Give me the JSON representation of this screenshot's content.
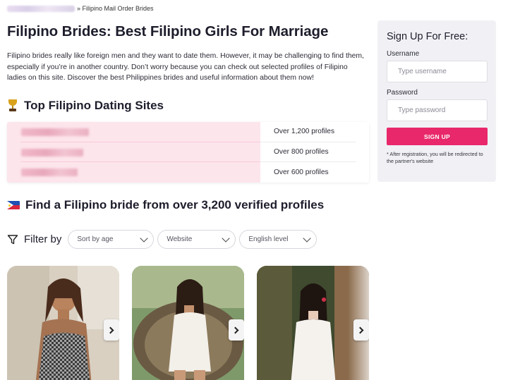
{
  "breadcrumb": {
    "current": "» Filipino Mail Order Brides"
  },
  "page": {
    "title": "Filipino Brides: Best Filipino Girls For Marriage",
    "intro": "Filipino brides really like foreign men and they want to date them. However, it may be challenging to find them, especially if you’re in another country. Don’t worry because you can check out selected profiles of Filipino ladies on this site. Discover the best Philippines brides and useful information about them now!"
  },
  "top_sites": {
    "heading": "Top Filipino Dating Sites",
    "rows": [
      {
        "profiles": "Over 1,200 profiles"
      },
      {
        "profiles": "Over 800 profiles"
      },
      {
        "profiles": "Over 600 profiles"
      }
    ]
  },
  "signup": {
    "title": "Sign Up For Free:",
    "username_label": "Username",
    "username_placeholder": "Type username",
    "password_label": "Password",
    "password_placeholder": "Type password",
    "button_label": "SIGN UP",
    "note": "* After registration, you will be redirected to the partner's website"
  },
  "find": {
    "heading": "Find a Filipino bride from over 3,200 verified profiles"
  },
  "filter": {
    "label": "Filter by",
    "selects": [
      {
        "value": "Sort by age"
      },
      {
        "value": "Website"
      },
      {
        "value": "English level"
      }
    ]
  },
  "icons": {
    "trophy": "trophy-icon",
    "flag": "philippines-flag-icon",
    "filter": "funnel-icon",
    "chevron": "chevron-down-icon",
    "next": "chevron-right-icon"
  },
  "colors": {
    "accent": "#e8286a",
    "table_highlight": "#fde5ec",
    "sidebar_bg": "#f1f1f5"
  }
}
